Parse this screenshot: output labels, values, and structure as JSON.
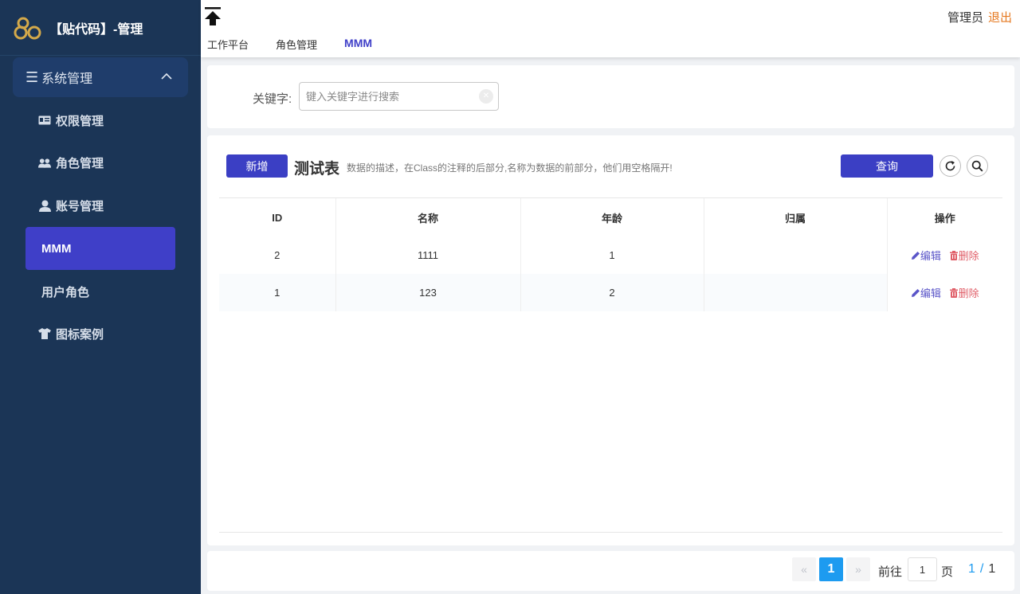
{
  "brand": {
    "title": "【贴代码】-管理"
  },
  "sidebar": {
    "group": {
      "label": "系统管理",
      "icon": "hamburger-icon",
      "expanded": true
    },
    "items": [
      {
        "label": "权限管理",
        "icon": "id-card-icon"
      },
      {
        "label": "角色管理",
        "icon": "users-icon"
      },
      {
        "label": "账号管理",
        "icon": "user-icon"
      },
      {
        "label": "MMM",
        "icon": "",
        "active": true
      },
      {
        "label": "用户角色",
        "icon": ""
      },
      {
        "label": "图标案例",
        "icon": "tshirt-icon"
      }
    ]
  },
  "header": {
    "tabs": [
      {
        "label": "工作平台"
      },
      {
        "label": "角色管理"
      },
      {
        "label": "MMM",
        "active": true
      }
    ],
    "user": "管理员",
    "logout": "退出"
  },
  "search": {
    "label": "关键字:",
    "placeholder": "键入关键字进行搜索",
    "value": ""
  },
  "toolbar": {
    "add_label": "新增",
    "title": "测试表",
    "description": "数据的描述，在Class的注释的后部分,名称为数据的前部分，他们用空格隔开!",
    "query_label": "查询"
  },
  "table": {
    "columns": [
      "ID",
      "名称",
      "年龄",
      "归属",
      "操作"
    ],
    "rows": [
      {
        "id": "2",
        "name": "1111",
        "age": "1",
        "owner": ""
      },
      {
        "id": "1",
        "name": "123",
        "age": "2",
        "owner": ""
      }
    ],
    "edit_label": "编辑",
    "delete_label": "删除"
  },
  "pagination": {
    "prev": "«",
    "next": "»",
    "current": "1",
    "goto_label": "前往",
    "goto_value": "1",
    "unit": "页",
    "page_current": "1",
    "separator": "/",
    "page_total": "1"
  },
  "colors": {
    "sidebar_bg": "#1b3556",
    "accent": "#3f3fc8",
    "pager_active": "#1d9bf0",
    "logout": "#e67a22"
  }
}
